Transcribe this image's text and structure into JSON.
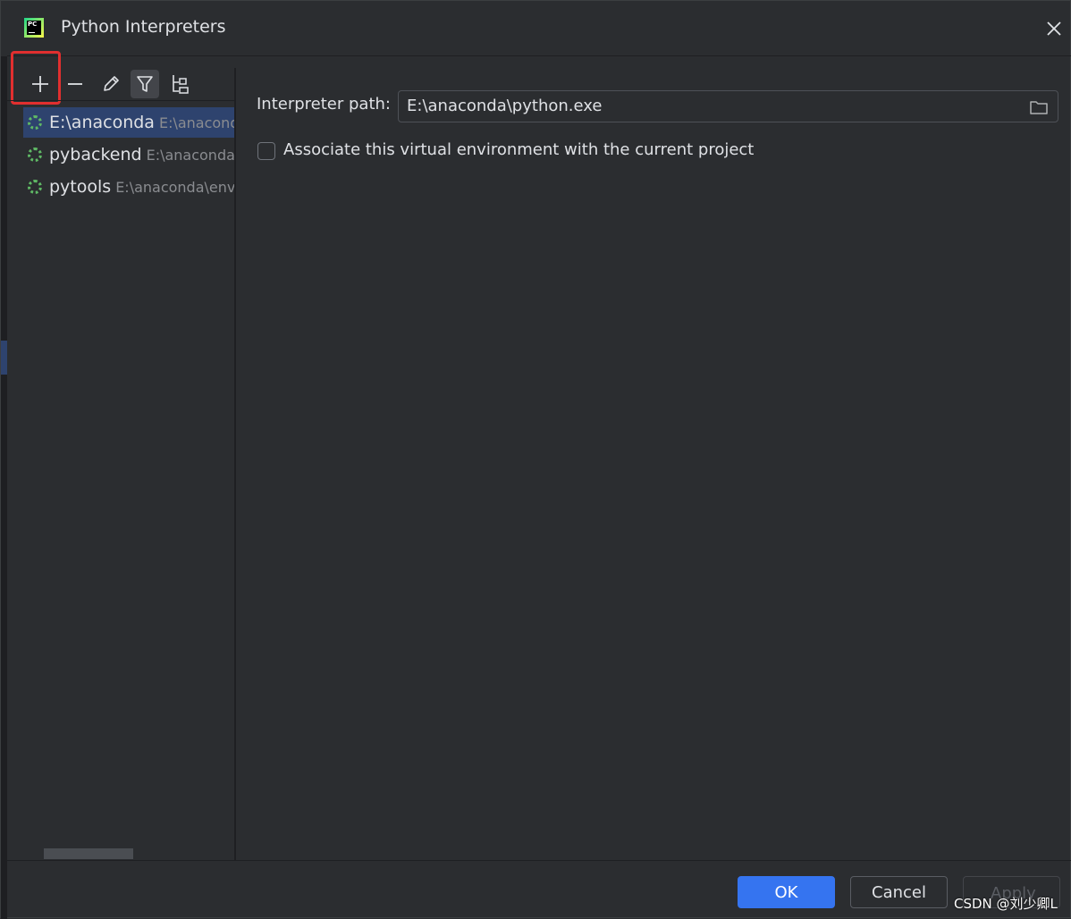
{
  "dialog": {
    "title": "Python Interpreters",
    "close_icon": "close-icon",
    "app_logo_text": "PC"
  },
  "toolbar": {
    "add_icon": "plus-icon",
    "remove_icon": "minus-icon",
    "edit_icon": "pencil-icon",
    "filter_icon": "filter-icon",
    "tree_icon": "show-paths-tree-icon"
  },
  "interpreters": [
    {
      "name": "E:\\anaconda",
      "path": "E:\\anaconda\\python.exe",
      "selected": true
    },
    {
      "name": "pybackend",
      "path": "E:\\anaconda\\envs\\pybackend\\python.exe",
      "selected": false
    },
    {
      "name": "pytools",
      "path": "E:\\anaconda\\envs\\pytools\\python.exe",
      "selected": false
    }
  ],
  "details": {
    "interpreter_path_label": "Interpreter path:",
    "interpreter_path_value": "E:\\anaconda\\python.exe",
    "associate_label": "Associate this virtual environment with the current project",
    "associate_checked": false
  },
  "buttons": {
    "ok": "OK",
    "cancel": "Cancel",
    "apply": "Apply"
  },
  "watermark": "CSDN @刘少卿L",
  "colors": {
    "background": "#2b2d30",
    "selection": "#2e436e",
    "accent": "#3574f0",
    "highlight_box": "#e12f2f",
    "env_ring": "#5fb865"
  }
}
